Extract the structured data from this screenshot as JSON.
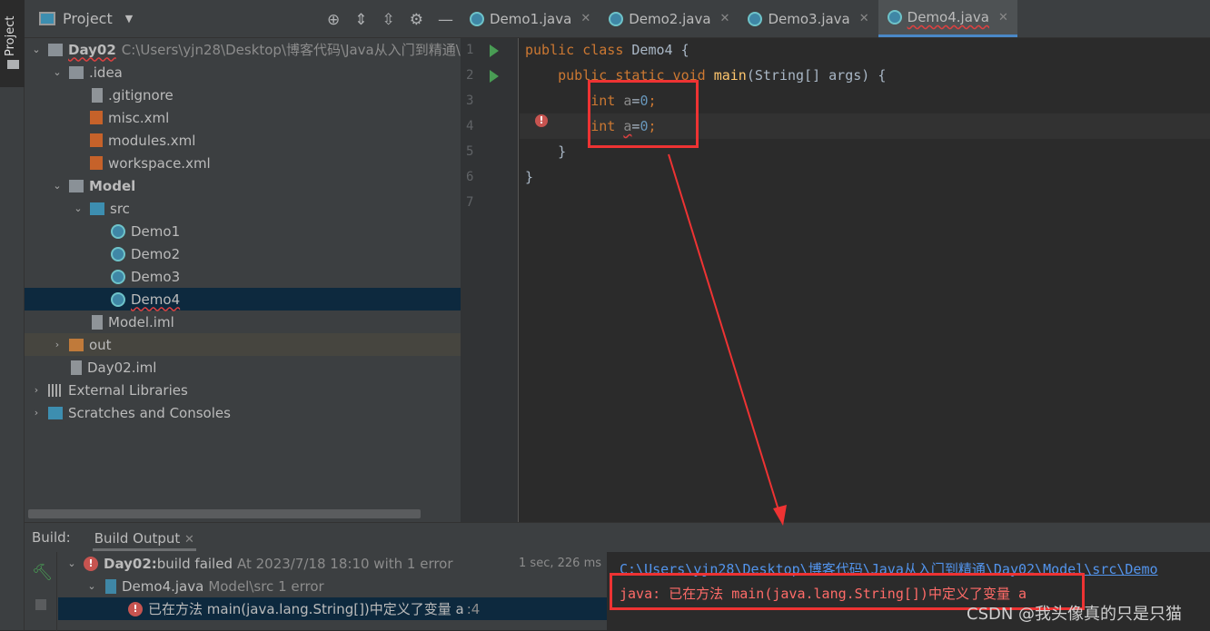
{
  "side_stripe": {
    "project_label": "Project"
  },
  "project": {
    "title": "Project",
    "tree": [
      {
        "label": "Day02",
        "path": "C:\\Users\\yjn28\\Desktop\\博客代码\\Java从入门到精通\\",
        "icon": "module-folder-icon"
      },
      {
        "label": ".idea",
        "icon": "folder-icon"
      },
      {
        "label": ".gitignore",
        "icon": "ignore-file-icon"
      },
      {
        "label": "misc.xml",
        "icon": "xml-icon"
      },
      {
        "label": "modules.xml",
        "icon": "xml-icon"
      },
      {
        "label": "workspace.xml",
        "icon": "xml-icon"
      },
      {
        "label": "Model",
        "icon": "module-folder-icon"
      },
      {
        "label": "src",
        "icon": "source-folder-icon"
      },
      {
        "label": "Demo1",
        "icon": "java-class-icon"
      },
      {
        "label": "Demo2",
        "icon": "java-class-icon"
      },
      {
        "label": "Demo3",
        "icon": "java-class-icon"
      },
      {
        "label": "Demo4",
        "icon": "java-class-icon"
      },
      {
        "label": "Model.iml",
        "icon": "iml-file-icon"
      },
      {
        "label": "out",
        "icon": "excluded-folder-icon"
      },
      {
        "label": "Day02.iml",
        "icon": "iml-file-icon"
      },
      {
        "label": "External Libraries",
        "icon": "library-icon"
      },
      {
        "label": "Scratches and Consoles",
        "icon": "scratches-icon"
      }
    ]
  },
  "editor": {
    "tabs": [
      {
        "label": "Demo1.java"
      },
      {
        "label": "Demo2.java"
      },
      {
        "label": "Demo3.java"
      },
      {
        "label": "Demo4.java",
        "active": true
      }
    ],
    "line_numbers": [
      "1",
      "2",
      "3",
      "4",
      "5",
      "6",
      "7"
    ],
    "code": {
      "l1a": "public class ",
      "l1b": "Demo4 {",
      "l2a": "    public static void ",
      "l2b": "main",
      "l2c": "(String[] args) {",
      "int": "int ",
      "a": "a",
      "eq": "=",
      "zero": "0",
      ";": ";",
      "close_inner": "    }",
      "close_outer": "}"
    }
  },
  "build": {
    "label": "Build:",
    "tab": "Build Output",
    "rows": [
      {
        "bold": "Day02:",
        "text": " build failed",
        "detail": "At 2023/7/18 18:10 with 1 error",
        "duration": "1 sec, 226 ms"
      },
      {
        "text": "Demo4.java",
        "detail": "Model\\src 1 error"
      },
      {
        "text": "已在方法 main(java.lang.String[])中定义了变量 a",
        "detail": ":4"
      }
    ],
    "console_link": "C:\\Users\\yjn28\\Desktop\\博客代码\\Java从入门到精通\\Day02\\Model\\src\\Demo",
    "console_error": "java: 已在方法 main(java.lang.String[])中定义了变量 a"
  },
  "watermark": "CSDN @我头像真的只是只猫",
  "colors": {
    "accent": "#4a88c7",
    "error": "#ff6b68",
    "annotation": "#ee3333"
  }
}
